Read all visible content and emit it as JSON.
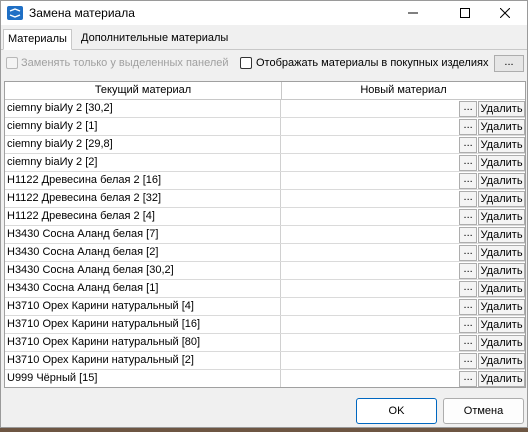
{
  "window": {
    "title": "Замена материала",
    "controls": {
      "minimize": "minimize-icon",
      "maximize": "maximize-icon",
      "close": "close-icon"
    }
  },
  "tabs": [
    {
      "label": "Материалы",
      "active": true
    },
    {
      "label": "Дополнительные материалы",
      "active": false
    }
  ],
  "options": {
    "replace_selected_label": "Заменять только у выделенных панелей",
    "show_purchased_label": "Отображать материалы в покупных изделиях",
    "more_label": "..."
  },
  "table": {
    "columns": [
      "Текущий материал",
      "Новый материал"
    ],
    "browse_label": "...",
    "delete_label": "Удалить",
    "rows": [
      {
        "current": "ciemny biaИу 2 [30,2]",
        "new": ""
      },
      {
        "current": "ciemny biaИу 2 [1]",
        "new": ""
      },
      {
        "current": "ciemny biaИу 2 [29,8]",
        "new": ""
      },
      {
        "current": "ciemny biaИу 2 [2]",
        "new": ""
      },
      {
        "current": "H1122 Древесина белая 2 [16]",
        "new": ""
      },
      {
        "current": "H1122 Древесина белая 2 [32]",
        "new": ""
      },
      {
        "current": "H1122 Древесина белая 2 [4]",
        "new": ""
      },
      {
        "current": "H3430 Сосна Аланд белая [7]",
        "new": ""
      },
      {
        "current": "H3430 Сосна Аланд белая [2]",
        "new": ""
      },
      {
        "current": "H3430 Сосна Аланд белая [30,2]",
        "new": ""
      },
      {
        "current": "H3430 Сосна Аланд белая [1]",
        "new": ""
      },
      {
        "current": "H3710 Орех Карини натуральный [4]",
        "new": ""
      },
      {
        "current": "H3710 Орех Карини натуральный [16]",
        "new": ""
      },
      {
        "current": "H3710 Орех Карини натуральный [80]",
        "new": ""
      },
      {
        "current": "H3710 Орех Карини натуральный [2]",
        "new": ""
      },
      {
        "current": "U999 Чёрный [15]",
        "new": ""
      }
    ]
  },
  "footer": {
    "ok_label": "OK",
    "cancel_label": "Отмена"
  },
  "colors": {
    "accent": "#0067c0",
    "window_bg": "#f0f0f0",
    "icon_blue": "#1f6fc5"
  }
}
